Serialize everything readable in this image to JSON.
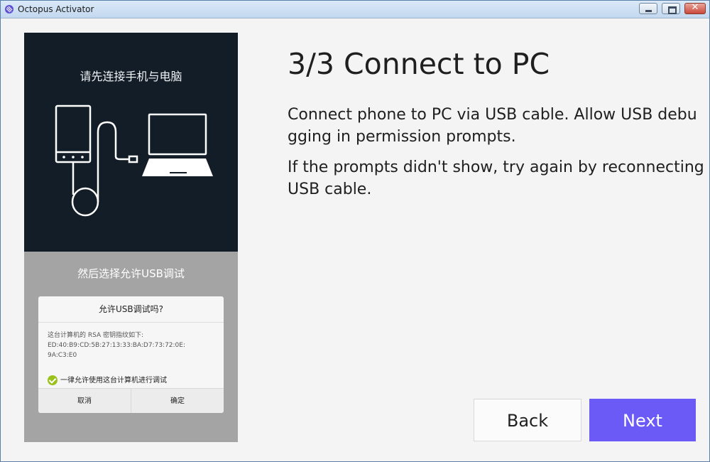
{
  "window": {
    "title": "Octopus Activator",
    "icon": "octopus-app-icon",
    "controls": [
      "minimize",
      "maximize",
      "close"
    ],
    "close_glyph": "✕"
  },
  "illustration": {
    "caption_top": "请先连接手机与电脑",
    "caption_bottom": "然后选择允许USB调试",
    "dialog": {
      "title": "允许USB调试吗?",
      "body_line1": "这台计算机的 RSA 密钥指纹如下:",
      "body_line2": "ED:40:B9:CD:5B:27:13:33:BA:D7:73:72:0E:",
      "body_line3": "9A:C3:E0",
      "checkbox_label": "一律允许使用这台计算机进行调试",
      "cancel_label": "取消",
      "ok_label": "确定"
    }
  },
  "main": {
    "heading": "3/3 Connect to PC",
    "paragraph1": "Connect phone to PC via USB cable. Allow USB debugging in permission prompts.",
    "paragraph2": "If the prompts didn't show, try again by reconnecting USB cable."
  },
  "buttons": {
    "back_label": "Back",
    "next_label": "Next"
  },
  "colors": {
    "accent": "#6b5af5",
    "illustration_dark": "#131d27",
    "illustration_gray": "#a4a4a4",
    "check_green": "#9bc11b"
  }
}
